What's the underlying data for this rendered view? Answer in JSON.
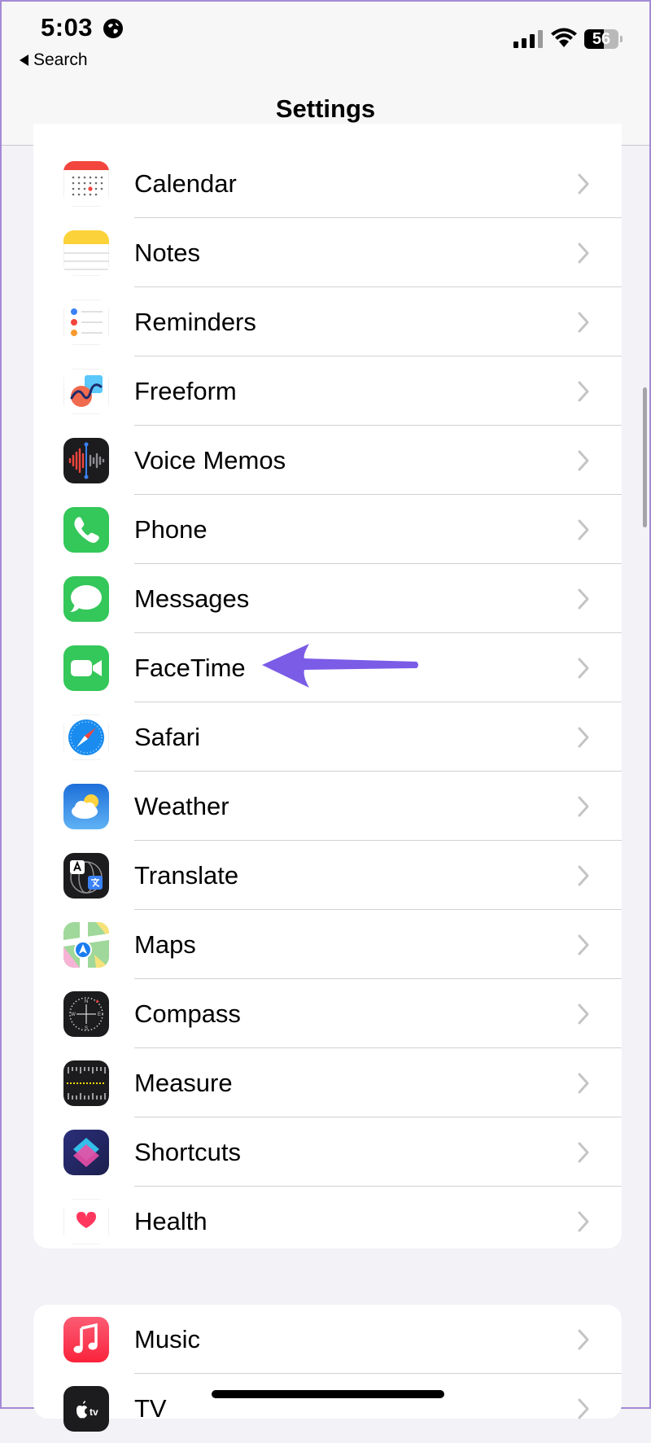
{
  "status_bar": {
    "time": "5:03",
    "battery": "56",
    "battery_level": 0.56
  },
  "nav": {
    "back_label": "Search",
    "title": "Settings"
  },
  "groups": [
    {
      "items": [
        {
          "label": "Calendar",
          "icon": "calendar-icon"
        },
        {
          "label": "Notes",
          "icon": "notes-icon"
        },
        {
          "label": "Reminders",
          "icon": "reminders-icon"
        },
        {
          "label": "Freeform",
          "icon": "freeform-icon"
        },
        {
          "label": "Voice Memos",
          "icon": "voice-memos-icon"
        },
        {
          "label": "Phone",
          "icon": "phone-icon"
        },
        {
          "label": "Messages",
          "icon": "messages-icon"
        },
        {
          "label": "FaceTime",
          "icon": "facetime-icon"
        },
        {
          "label": "Safari",
          "icon": "safari-icon"
        },
        {
          "label": "Weather",
          "icon": "weather-icon"
        },
        {
          "label": "Translate",
          "icon": "translate-icon"
        },
        {
          "label": "Maps",
          "icon": "maps-icon"
        },
        {
          "label": "Compass",
          "icon": "compass-icon"
        },
        {
          "label": "Measure",
          "icon": "measure-icon"
        },
        {
          "label": "Shortcuts",
          "icon": "shortcuts-icon"
        },
        {
          "label": "Health",
          "icon": "health-icon"
        }
      ]
    },
    {
      "items": [
        {
          "label": "Music",
          "icon": "music-icon"
        },
        {
          "label": "TV",
          "icon": "tv-icon"
        }
      ]
    }
  ],
  "annotation": {
    "target": "FaceTime",
    "color": "#7b5ce6"
  },
  "colors": {
    "background": "#f2f2f7",
    "separator": "#d1d1d6",
    "chevron": "#c4c4c7"
  }
}
